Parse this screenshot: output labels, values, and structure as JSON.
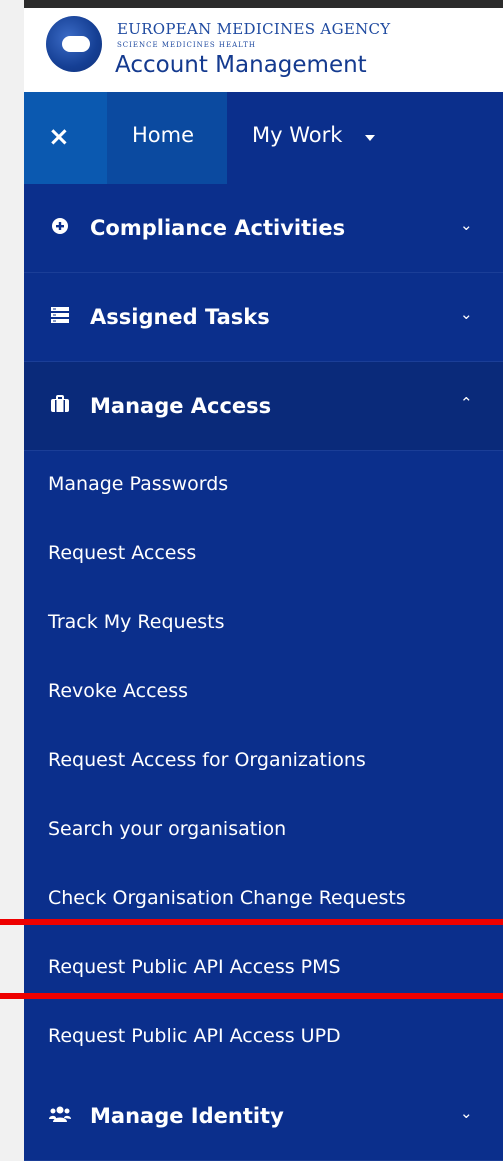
{
  "header": {
    "org_name": "EUROPEAN MEDICINES AGENCY",
    "org_tagline": "SCIENCE   MEDICINES   HEALTH",
    "app_title": "Account Management"
  },
  "topnav": {
    "close_icon": "×",
    "home_label": "Home",
    "mywork_label": "My Work"
  },
  "sections": {
    "compliance": {
      "label": "Compliance Activities",
      "icon": "plus-circle-icon",
      "chevron": "⌄"
    },
    "assigned": {
      "label": "Assigned Tasks",
      "icon": "list-icon",
      "chevron": "⌄"
    },
    "manage_access": {
      "label": "Manage Access",
      "icon": "briefcase-icon",
      "chevron": "⌃"
    },
    "manage_identity": {
      "label": "Manage Identity",
      "icon": "users-icon",
      "chevron": "⌄"
    }
  },
  "manage_access_items": [
    "Manage Passwords",
    "Request Access",
    "Track My Requests",
    "Revoke Access",
    "Request Access for Organizations",
    "Search your organisation",
    "Check Organisation Change Requests",
    "Request Public API Access PMS",
    "Request Public API Access UPD"
  ],
  "colors": {
    "menu_bg": "#0b2f8c",
    "highlight_line": "#ee0000",
    "close_bg": "#0b59b0"
  }
}
